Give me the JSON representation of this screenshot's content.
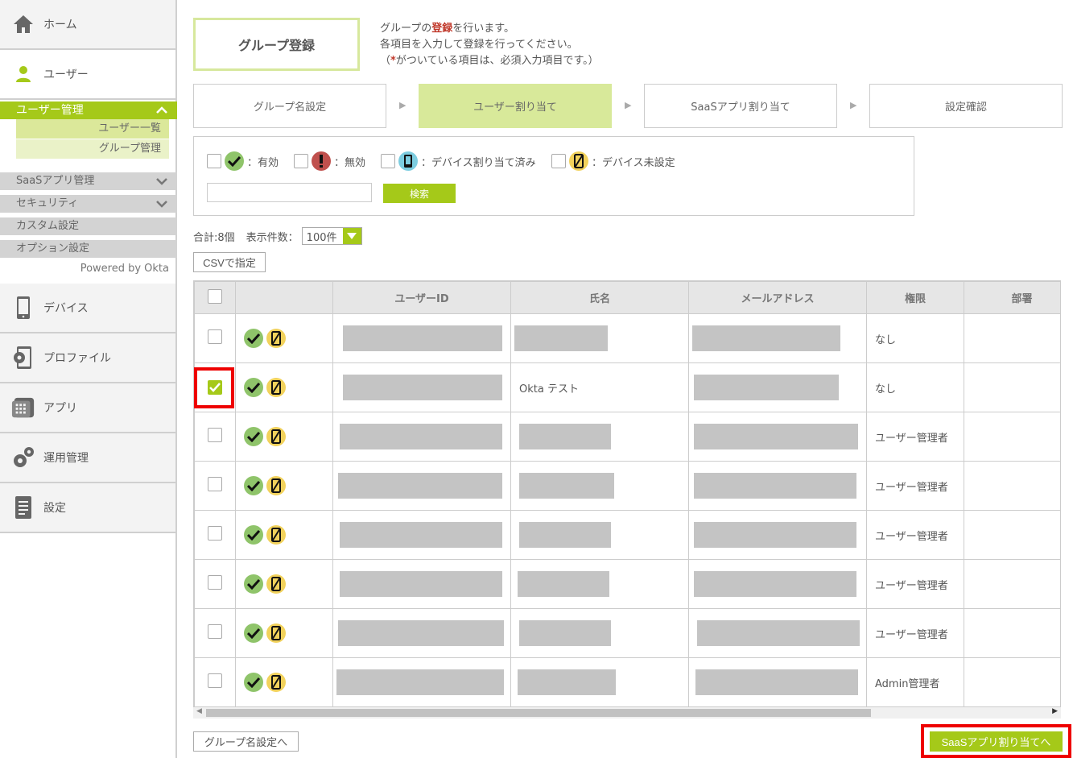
{
  "sidebar": {
    "home": "ホーム",
    "user": "ユーザー",
    "user_mgmt": "ユーザー管理",
    "user_list": "ユーザー一覧",
    "group_mgmt": "グループ管理",
    "saas_mgmt": "SaaSアプリ管理",
    "security": "セキュリティ",
    "custom": "カスタム設定",
    "option": "オプション設定",
    "powered": "Powered by Okta",
    "device": "デバイス",
    "profile": "プロファイル",
    "app": "アプリ",
    "ops": "運用管理",
    "settings": "設定"
  },
  "page": {
    "title": "グループ登録",
    "desc_pre": "グループの",
    "desc_red": "登録",
    "desc_post": "を行います。",
    "desc2": "各項目を入力して登録を行ってください。",
    "desc3_open": "（",
    "desc3_star": "*",
    "desc3_rest": "がついている項目は、必須入力項目です。）"
  },
  "steps": [
    "グループ名設定",
    "ユーザー割り当て",
    "SaaSアプリ割り当て",
    "設定確認"
  ],
  "filter": {
    "valid": "：有効",
    "invalid": "：無効",
    "device_assigned": "：デバイス割り当て済み",
    "device_unset": "：デバイス未設定",
    "search_placeholder": "",
    "search_btn": "検索"
  },
  "list": {
    "total": "合計:8個",
    "per_page_label": "表示件数：",
    "per_page_value": "100件",
    "csv_btn": "CSVで指定"
  },
  "table": {
    "headers": [
      "ユーザーID",
      "氏名",
      "メールアドレス",
      "権限",
      "部署"
    ],
    "rows": [
      {
        "name": "",
        "perm": "なし",
        "checked": false
      },
      {
        "name": "Okta テスト",
        "perm": "なし",
        "checked": true
      },
      {
        "name": "",
        "perm": "ユーザー管理者",
        "checked": false
      },
      {
        "name": "",
        "perm": "ユーザー管理者",
        "checked": false
      },
      {
        "name": "",
        "perm": "ユーザー管理者",
        "checked": false
      },
      {
        "name": "",
        "perm": "ユーザー管理者",
        "checked": false
      },
      {
        "name": "",
        "perm": "ユーザー管理者",
        "checked": false
      },
      {
        "name": "",
        "perm": "Admin管理者",
        "checked": false
      }
    ]
  },
  "footer": {
    "back_btn": "グループ名設定へ",
    "next_btn": "SaaSアプリ割り当てへ"
  }
}
